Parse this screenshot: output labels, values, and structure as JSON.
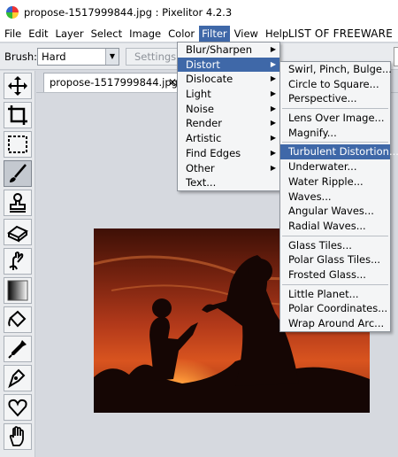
{
  "window": {
    "title": "propose-1517999844.jpg : Pixelitor 4.2.3"
  },
  "menubar": {
    "items": [
      "File",
      "Edit",
      "Layer",
      "Select",
      "Image",
      "Color",
      "Filter",
      "View",
      "Help"
    ],
    "active": "Filter",
    "brand": "LIST OF FREEWARE"
  },
  "options": {
    "brush_label": "Brush:",
    "brush_value": "Hard",
    "settings_label": "Settings..."
  },
  "tab": {
    "label": "propose-1517999844.jpg",
    "close": "✕"
  },
  "tools": [
    "move-tool-icon",
    "crop-tool-icon",
    "selection-tool-icon",
    "brush-tool-icon",
    "clone-stamp-tool-icon",
    "eraser-tool-icon",
    "smudge-tool-icon",
    "gradient-tool-icon",
    "paint-bucket-tool-icon",
    "color-picker-tool-icon",
    "pen-tool-icon",
    "shapes-tool-icon",
    "hand-tool-icon"
  ],
  "filter_menu": {
    "items": [
      {
        "label": "Blur/Sharpen",
        "submenu": true
      },
      {
        "label": "Distort",
        "submenu": true,
        "highlighted": true
      },
      {
        "label": "Dislocate",
        "submenu": true
      },
      {
        "label": "Light",
        "submenu": true
      },
      {
        "label": "Noise",
        "submenu": true
      },
      {
        "label": "Render",
        "submenu": true
      },
      {
        "label": "Artistic",
        "submenu": true
      },
      {
        "label": "Find Edges",
        "submenu": true
      },
      {
        "label": "Other",
        "submenu": true
      },
      {
        "label": "Text...",
        "submenu": false
      }
    ]
  },
  "distort_menu": {
    "groups": [
      [
        "Swirl, Pinch, Bulge...",
        "Circle to Square...",
        "Perspective..."
      ],
      [
        "Lens Over Image...",
        "Magnify..."
      ],
      [
        "Turbulent Distortion...",
        "Underwater...",
        "Water Ripple...",
        "Waves...",
        "Angular Waves...",
        "Radial Waves..."
      ],
      [
        "Glass Tiles...",
        "Polar Glass Tiles...",
        "Frosted Glass..."
      ],
      [
        "Little Planet...",
        "Polar Coordinates...",
        "Wrap Around Arc..."
      ]
    ],
    "highlighted": "Turbulent Distortion..."
  },
  "colors": {
    "menu_highlight": "#3f68a8",
    "background": "#d6d9df"
  }
}
